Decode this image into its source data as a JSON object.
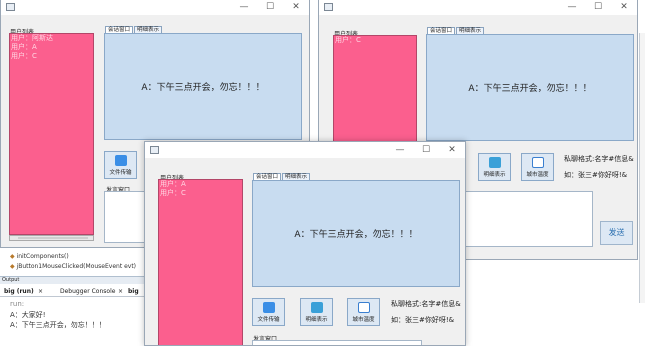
{
  "win_left": {
    "user_list_label": "用户列表",
    "users": [
      "用户：阿斯达",
      "用户：A",
      "用户：C"
    ],
    "tabs": [
      "会话窗口",
      "明细表示"
    ],
    "message": "A：下午三点开会，勿忘！！！",
    "file_button": "文件传输",
    "speak_label": "发言窗口"
  },
  "win_right": {
    "user_list_label": "用户列表",
    "users": [
      "用户：C"
    ],
    "tabs": [
      "会话窗口",
      "明细表示"
    ],
    "message": "A：下午三点开会，勿忘！！！",
    "detail_button": "明细表示",
    "temp_button": "城市温度",
    "hint_format": "私聊格式:名字#信息&",
    "hint_example": "如：张三#你好呀!&",
    "send_button": "发送"
  },
  "win_front": {
    "user_list_label": "用户列表",
    "users": [
      "用户：A",
      "用户：C"
    ],
    "tabs": [
      "会话窗口",
      "明细表示"
    ],
    "message": "A：下午三点开会，勿忘！！！",
    "file_button": "文件传输",
    "detail_button": "明细表示",
    "temp_button": "城市温度",
    "hint_format": "私聊格式:名字#信息&",
    "hint_example": "如：张三#你好呀!&",
    "speak_label": "发言窗口"
  },
  "window_controls": {
    "minimize": "—",
    "maximize": "☐",
    "close": "✕"
  },
  "ide": {
    "tree_lines": [
      "initComponents()",
      "jButton1MouseClicked(MouseEvent evt)"
    ],
    "output_label": "Output",
    "tab_run": "big (run)",
    "tab_debugger": "Debugger Console",
    "tab_big": "big",
    "tab_close": "×",
    "console_lines": [
      "run:",
      "A：大家好!",
      "A：下午三点开会，勿忘！！！"
    ]
  },
  "colors": {
    "user_list_bg": "#fb5f8e",
    "chat_pane_bg": "#c8dcf0",
    "window_bg": "#f0f0f0"
  }
}
